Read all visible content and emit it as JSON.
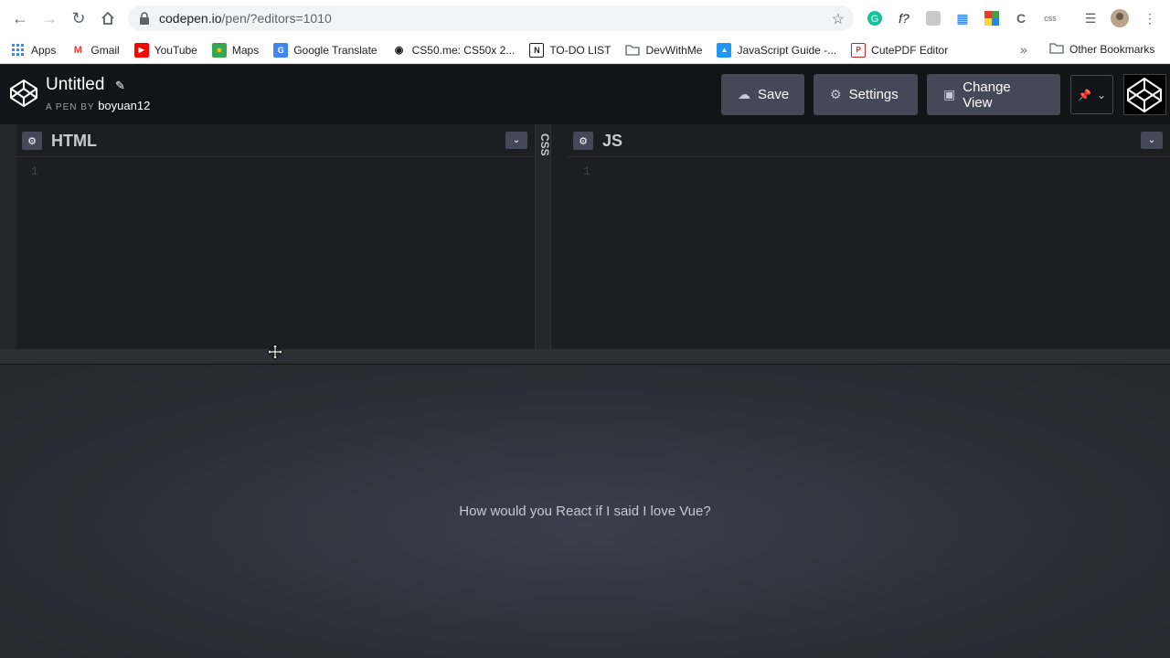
{
  "browser": {
    "url_host": "codepen.io",
    "url_path": "/pen/?editors=1010",
    "bookmarks": [
      {
        "label": "Apps",
        "icon": "apps-grid-icon"
      },
      {
        "label": "Gmail",
        "icon": "gmail-icon"
      },
      {
        "label": "YouTube",
        "icon": "youtube-icon"
      },
      {
        "label": "Maps",
        "icon": "maps-icon"
      },
      {
        "label": "Google Translate",
        "icon": "translate-icon"
      },
      {
        "label": "CS50.me: CS50x 2...",
        "icon": "cs50-icon"
      },
      {
        "label": "TO-DO LIST",
        "icon": "notion-icon"
      },
      {
        "label": "DevWithMe",
        "icon": "folder-icon"
      },
      {
        "label": "JavaScript Guide -...",
        "icon": "js-guide-icon"
      },
      {
        "label": "CutePDF Editor",
        "icon": "pdf-icon"
      }
    ],
    "more_label": "»",
    "other_bookmarks": "Other Bookmarks"
  },
  "pen": {
    "title": "Untitled",
    "by_prefix": "A PEN BY",
    "author": "boyuan12"
  },
  "toolbar": {
    "save_label": "Save",
    "settings_label": "Settings",
    "change_view_label": "Change View"
  },
  "editors": {
    "html_title": "HTML",
    "css_title": "CSS",
    "js_title": "JS",
    "html_line": "1",
    "js_line": "1"
  },
  "preview": {
    "text": "How would you React if I said I love Vue?"
  },
  "colors": {
    "header_bg": "#131417",
    "editor_bg": "#1d1e22",
    "button_bg": "#444857"
  }
}
